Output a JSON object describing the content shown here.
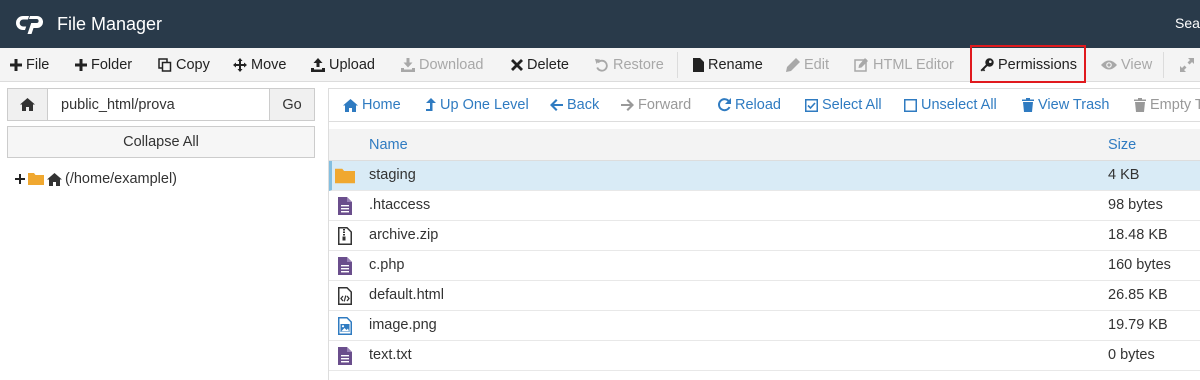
{
  "app": {
    "title": "File Manager",
    "search_label": "Search"
  },
  "toolbar": {
    "file": "File",
    "folder": "Folder",
    "copy": "Copy",
    "move": "Move",
    "upload": "Upload",
    "download": "Download",
    "delete": "Delete",
    "restore": "Restore",
    "rename": "Rename",
    "edit": "Edit",
    "html_editor": "HTML Editor",
    "permissions": "Permissions",
    "view": "View"
  },
  "left": {
    "path_value": "public_html/prova",
    "go_label": "Go",
    "collapse_label": "Collapse All",
    "tree_root": "(/home/examplel)"
  },
  "nav": {
    "home": "Home",
    "up": "Up One Level",
    "back": "Back",
    "forward": "Forward",
    "reload": "Reload",
    "select_all": "Select All",
    "unselect_all": "Unselect All",
    "view_trash": "View Trash",
    "empty_trash": "Empty Trash"
  },
  "table": {
    "columns": {
      "name": "Name",
      "size": "Size"
    },
    "rows": [
      {
        "name": "staging",
        "size": "4 KB",
        "icon": "folder-icon",
        "selected": true
      },
      {
        "name": ".htaccess",
        "size": "98 bytes",
        "icon": "text-file-icon"
      },
      {
        "name": "archive.zip",
        "size": "18.48 KB",
        "icon": "zip-file-icon"
      },
      {
        "name": "c.php",
        "size": "160 bytes",
        "icon": "text-file-icon"
      },
      {
        "name": "default.html",
        "size": "26.85 KB",
        "icon": "code-file-icon"
      },
      {
        "name": "image.png",
        "size": "19.79 KB",
        "icon": "image-file-icon"
      },
      {
        "name": "text.txt",
        "size": "0 bytes",
        "icon": "text-file-icon"
      }
    ]
  },
  "colors": {
    "topbar": "#293a4a",
    "link": "#2f7bc1",
    "selected_row": "#d9ebf6",
    "highlight": "#e0191d",
    "folder": "#f0a830",
    "file_purple": "#6a4e8c"
  }
}
